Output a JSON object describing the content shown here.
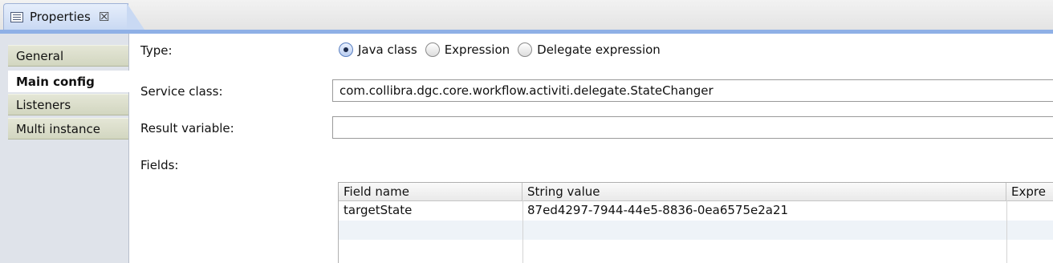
{
  "tab": {
    "title": "Properties",
    "close_glyph": "☒",
    "icon": "properties-icon"
  },
  "sidebar": {
    "items": [
      {
        "label": "General",
        "active": false
      },
      {
        "label": "Main config",
        "active": true
      },
      {
        "label": "Listeners",
        "active": false
      },
      {
        "label": "Multi instance",
        "active": false
      }
    ]
  },
  "form": {
    "type_label": "Type:",
    "type_options": [
      {
        "label": "Java class",
        "checked": true
      },
      {
        "label": "Expression",
        "checked": false
      },
      {
        "label": "Delegate expression",
        "checked": false
      }
    ],
    "service_class_label": "Service class:",
    "service_class_value": "com.collibra.dgc.core.workflow.activiti.delegate.StateChanger",
    "result_variable_label": "Result variable:",
    "result_variable_value": "",
    "fields_label": "Fields:"
  },
  "fields_table": {
    "columns": [
      "Field name",
      "String value",
      "Expre"
    ],
    "rows": [
      [
        "targetState",
        "87ed4297-7944-44e5-8836-0ea6575e2a21",
        ""
      ]
    ]
  },
  "colors": {
    "accent": "#8fb0e6",
    "tab": "#c9d9f3",
    "sidebar_item": "#d2d6c0"
  }
}
